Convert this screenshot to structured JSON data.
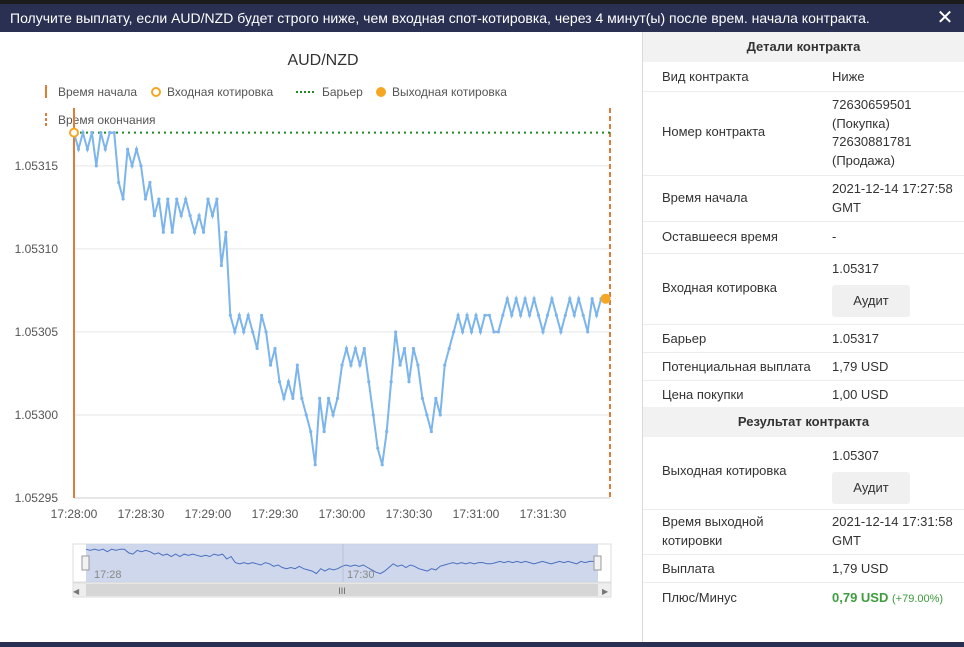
{
  "header": {
    "message": "Получите выплату, если AUD/NZD будет строго ниже, чем входная спот-котировка, через 4 минут(ы) после врем. начала контракта.",
    "close_symbol": "✕"
  },
  "chart_data": {
    "type": "line",
    "title": "AUD/NZD",
    "legend": [
      "Время начала",
      "Входная котировка",
      "Барьер",
      "Выходная котировка",
      "Время окончания"
    ],
    "x_ticks": [
      "17:28:00",
      "17:28:30",
      "17:29:00",
      "17:29:30",
      "17:30:00",
      "17:30:30",
      "17:31:00",
      "17:31:30"
    ],
    "y_ticks": [
      "1.05315",
      "1.05310",
      "1.05305",
      "1.05300",
      "1.05295"
    ],
    "ylim": [
      1.05295,
      1.05318
    ],
    "barrier": 1.05317,
    "entry": {
      "t": 0,
      "value": 1.05317
    },
    "exit": {
      "t": 238,
      "value": 1.05307
    },
    "series": [
      {
        "t": [
          0,
          2,
          4,
          6,
          8,
          10,
          12,
          14,
          16,
          18,
          20,
          22,
          24,
          26,
          28,
          30,
          32,
          34,
          36,
          38,
          40,
          42,
          44,
          46,
          48,
          50,
          52,
          54,
          56,
          58,
          60,
          62,
          64,
          66,
          68,
          70,
          72,
          74,
          76,
          78,
          80,
          82,
          84,
          86,
          88,
          90,
          92,
          94,
          96,
          98,
          100,
          102,
          104,
          106,
          108,
          110,
          112,
          114,
          116,
          118,
          120,
          122,
          124,
          126,
          128,
          130,
          132,
          134,
          136,
          138,
          140,
          142,
          144,
          146,
          148,
          150,
          152,
          154,
          156,
          158,
          160,
          162,
          164,
          166,
          168,
          170,
          172,
          174,
          176,
          178,
          180,
          182,
          184,
          186,
          188,
          190,
          192,
          194,
          196,
          198,
          200,
          202,
          204,
          206,
          208,
          210,
          212,
          214,
          216,
          218,
          220,
          222,
          224,
          226,
          228,
          230,
          232,
          234,
          236,
          238
        ],
        "values": [
          1.05317,
          1.05316,
          1.05317,
          1.05316,
          1.05317,
          1.05315,
          1.05317,
          1.05316,
          1.05317,
          1.05317,
          1.05314,
          1.05313,
          1.05316,
          1.05315,
          1.05316,
          1.05315,
          1.05313,
          1.05314,
          1.05312,
          1.05313,
          1.05311,
          1.05313,
          1.05311,
          1.05313,
          1.05312,
          1.05313,
          1.05312,
          1.05311,
          1.05312,
          1.05311,
          1.05313,
          1.05312,
          1.05313,
          1.05309,
          1.05311,
          1.05306,
          1.05305,
          1.05306,
          1.05305,
          1.05306,
          1.05305,
          1.05304,
          1.05306,
          1.05305,
          1.05303,
          1.05304,
          1.05302,
          1.05301,
          1.05302,
          1.05301,
          1.05303,
          1.05301,
          1.053,
          1.05299,
          1.05297,
          1.05301,
          1.05299,
          1.05301,
          1.053,
          1.05301,
          1.05303,
          1.05304,
          1.05303,
          1.05304,
          1.05303,
          1.05304,
          1.05302,
          1.053,
          1.05298,
          1.05297,
          1.05299,
          1.05302,
          1.05305,
          1.05303,
          1.05304,
          1.05302,
          1.05304,
          1.05303,
          1.05301,
          1.053,
          1.05299,
          1.05301,
          1.053,
          1.05303,
          1.05304,
          1.05305,
          1.05306,
          1.05305,
          1.05306,
          1.05305,
          1.05306,
          1.05305,
          1.05306,
          1.05306,
          1.05305,
          1.05305,
          1.05306,
          1.05307,
          1.05306,
          1.05307,
          1.05306,
          1.05307,
          1.05306,
          1.05307,
          1.05306,
          1.05305,
          1.05306,
          1.05307,
          1.05306,
          1.05305,
          1.05306,
          1.05307,
          1.05306,
          1.05307,
          1.05306,
          1.05305,
          1.05307,
          1.05306,
          1.05307,
          1.05307
        ]
      }
    ]
  },
  "navigator": {
    "label_1": "17:28",
    "label_2": "17:30",
    "scroll_grip": "III",
    "arrow_left": "◀",
    "arrow_right": "▶"
  },
  "details": {
    "header": "Детали контракта",
    "type_label": "Вид контракта",
    "type_value": "Ниже",
    "number_label": "Номер контракта",
    "number_line1": "72630659501",
    "number_line2": "(Покупка)",
    "number_line3": "72630881781",
    "number_line4": "(Продажа)",
    "start_label": "Время начала",
    "start_line1": "2021-12-14 17:27:58",
    "start_line2": "GMT",
    "remaining_label": "Оставшееся время",
    "remaining_value": "-",
    "entry_label": "Входная котировка",
    "entry_value": "1.05317",
    "audit_label": "Аудит",
    "barrier_label": "Барьер",
    "barrier_value": "1.05317",
    "payout_label": "Потенциальная выплата",
    "payout_value": "1,79 USD",
    "price_label": "Цена покупки",
    "price_value": "1,00 USD"
  },
  "result": {
    "header": "Результат контракта",
    "exit_label": "Выходная котировка",
    "exit_value": "1.05307",
    "audit_label": "Аудит",
    "exit_time_label_1": "Время выходной",
    "exit_time_label_2": "котировки",
    "exit_time_line1": "2021-12-14 17:31:58",
    "exit_time_line2": "GMT",
    "payout_label": "Выплата",
    "payout_value": "1,79 USD",
    "pl_label": "Плюс/Минус",
    "pl_value": "0,79 USD",
    "pl_percent": "(+79.00%)"
  },
  "colors": {
    "header_bg": "#2a3052",
    "series": "#7cb5ec",
    "entry_marker": "#f5a623",
    "barrier": "#1e8a1e",
    "start_line": "#e07b39",
    "profit": "#3d9c3d"
  }
}
